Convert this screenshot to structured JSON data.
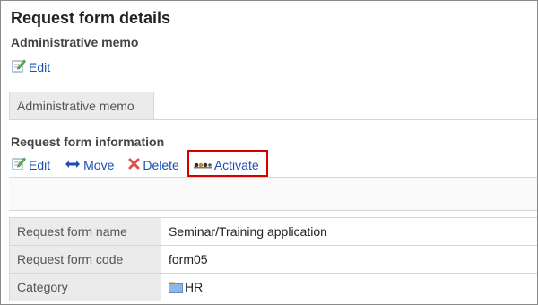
{
  "page": {
    "title": "Request form details"
  },
  "admin_memo": {
    "section_title": "Administrative memo",
    "edit_label": "Edit",
    "field_label": "Administrative memo",
    "field_value": ""
  },
  "form_info": {
    "section_title": "Request form information",
    "actions": {
      "edit": "Edit",
      "move": "Move",
      "delete": "Delete",
      "activate": "Activate"
    },
    "rows": [
      {
        "label": "Request form name",
        "value": "Seminar/Training application"
      },
      {
        "label": "Request form code",
        "value": "form05"
      },
      {
        "label": "Category",
        "value": "HR"
      }
    ]
  },
  "colors": {
    "link": "#1a4fb4",
    "highlight": "#d40000",
    "delete_icon": "#d9534f"
  },
  "icons": {
    "edit": "edit-pencil-icon",
    "move": "move-arrows-icon",
    "delete": "delete-x-icon",
    "activate": "activate-icon",
    "folder": "folder-icon"
  }
}
